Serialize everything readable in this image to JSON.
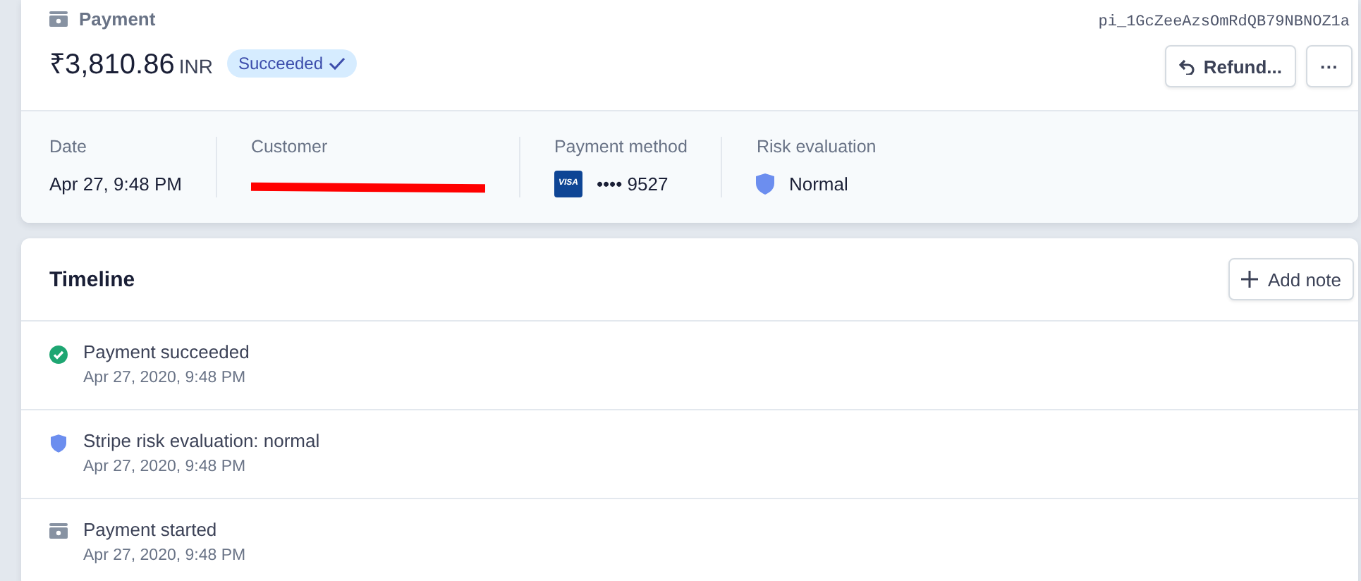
{
  "header": {
    "label": "Payment",
    "payment_id": "pi_1GcZeeAzsOmRdQB79NBNOZ1a",
    "amount": "₹3,810.86",
    "currency": "INR",
    "status": "Succeeded",
    "buttons": [
      {
        "kind": "refund",
        "label": "Refund..."
      },
      {
        "kind": "more",
        "label": "···"
      }
    ]
  },
  "details": [
    {
      "kind": "text",
      "label": "Date",
      "value": "Apr 27, 9:48 PM"
    },
    {
      "kind": "redacted",
      "label": "Customer"
    },
    {
      "kind": "card",
      "label": "Payment method",
      "value": "•••• 9527",
      "brand": "VISA"
    },
    {
      "kind": "risk",
      "label": "Risk evaluation",
      "value": "Normal"
    }
  ],
  "timeline": {
    "title": "Timeline",
    "add_button": "Add note",
    "items": [
      {
        "kind": "success",
        "title": "Payment succeeded",
        "time": "Apr 27, 2020, 9:48 PM"
      },
      {
        "kind": "risk",
        "title": "Stripe risk evaluation: normal",
        "time": "Apr 27, 2020, 9:48 PM"
      },
      {
        "kind": "started",
        "title": "Payment started",
        "time": "Apr 27, 2020, 9:48 PM"
      }
    ]
  }
}
